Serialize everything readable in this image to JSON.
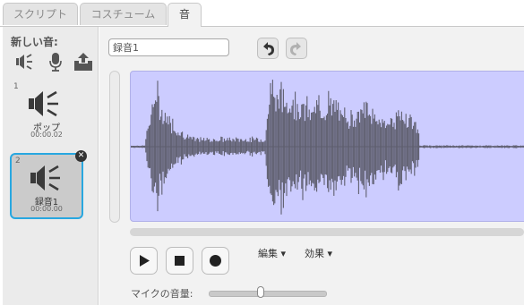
{
  "tabs": [
    {
      "label": "スクリプト"
    },
    {
      "label": "コスチューム"
    },
    {
      "label": "音"
    }
  ],
  "sounds_panel": {
    "new_sound_label": "新しい音:",
    "new_icons": [
      "sound-library-icon",
      "record-microphone-icon",
      "upload-sound-icon"
    ],
    "items": [
      {
        "number": "1",
        "name": "ポップ",
        "duration": "00:00.02",
        "selected": false
      },
      {
        "number": "2",
        "name": "録音1",
        "duration": "00:00.00",
        "selected": true
      }
    ]
  },
  "editor": {
    "sound_name": "録音1",
    "edit_menu": "編集 ▾",
    "effects_menu": "効果 ▾",
    "mic_volume_label": "マイクの音量:",
    "mic_volume_level": 0.44,
    "waveform_color": "#5e5e6e",
    "waveform_bg": "#ccccff"
  }
}
